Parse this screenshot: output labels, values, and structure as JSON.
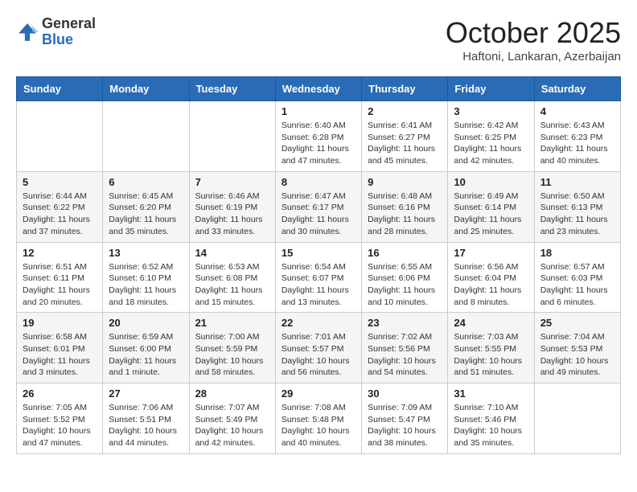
{
  "header": {
    "logo": {
      "general": "General",
      "blue": "Blue"
    },
    "month": "October 2025",
    "location": "Haftoni, Lankaran, Azerbaijan"
  },
  "weekdays": [
    "Sunday",
    "Monday",
    "Tuesday",
    "Wednesday",
    "Thursday",
    "Friday",
    "Saturday"
  ],
  "weeks": [
    [
      {
        "day": "",
        "info": ""
      },
      {
        "day": "",
        "info": ""
      },
      {
        "day": "",
        "info": ""
      },
      {
        "day": "1",
        "info": "Sunrise: 6:40 AM\nSunset: 6:28 PM\nDaylight: 11 hours\nand 47 minutes."
      },
      {
        "day": "2",
        "info": "Sunrise: 6:41 AM\nSunset: 6:27 PM\nDaylight: 11 hours\nand 45 minutes."
      },
      {
        "day": "3",
        "info": "Sunrise: 6:42 AM\nSunset: 6:25 PM\nDaylight: 11 hours\nand 42 minutes."
      },
      {
        "day": "4",
        "info": "Sunrise: 6:43 AM\nSunset: 6:23 PM\nDaylight: 11 hours\nand 40 minutes."
      }
    ],
    [
      {
        "day": "5",
        "info": "Sunrise: 6:44 AM\nSunset: 6:22 PM\nDaylight: 11 hours\nand 37 minutes."
      },
      {
        "day": "6",
        "info": "Sunrise: 6:45 AM\nSunset: 6:20 PM\nDaylight: 11 hours\nand 35 minutes."
      },
      {
        "day": "7",
        "info": "Sunrise: 6:46 AM\nSunset: 6:19 PM\nDaylight: 11 hours\nand 33 minutes."
      },
      {
        "day": "8",
        "info": "Sunrise: 6:47 AM\nSunset: 6:17 PM\nDaylight: 11 hours\nand 30 minutes."
      },
      {
        "day": "9",
        "info": "Sunrise: 6:48 AM\nSunset: 6:16 PM\nDaylight: 11 hours\nand 28 minutes."
      },
      {
        "day": "10",
        "info": "Sunrise: 6:49 AM\nSunset: 6:14 PM\nDaylight: 11 hours\nand 25 minutes."
      },
      {
        "day": "11",
        "info": "Sunrise: 6:50 AM\nSunset: 6:13 PM\nDaylight: 11 hours\nand 23 minutes."
      }
    ],
    [
      {
        "day": "12",
        "info": "Sunrise: 6:51 AM\nSunset: 6:11 PM\nDaylight: 11 hours\nand 20 minutes."
      },
      {
        "day": "13",
        "info": "Sunrise: 6:52 AM\nSunset: 6:10 PM\nDaylight: 11 hours\nand 18 minutes."
      },
      {
        "day": "14",
        "info": "Sunrise: 6:53 AM\nSunset: 6:08 PM\nDaylight: 11 hours\nand 15 minutes."
      },
      {
        "day": "15",
        "info": "Sunrise: 6:54 AM\nSunset: 6:07 PM\nDaylight: 11 hours\nand 13 minutes."
      },
      {
        "day": "16",
        "info": "Sunrise: 6:55 AM\nSunset: 6:06 PM\nDaylight: 11 hours\nand 10 minutes."
      },
      {
        "day": "17",
        "info": "Sunrise: 6:56 AM\nSunset: 6:04 PM\nDaylight: 11 hours\nand 8 minutes."
      },
      {
        "day": "18",
        "info": "Sunrise: 6:57 AM\nSunset: 6:03 PM\nDaylight: 11 hours\nand 6 minutes."
      }
    ],
    [
      {
        "day": "19",
        "info": "Sunrise: 6:58 AM\nSunset: 6:01 PM\nDaylight: 11 hours\nand 3 minutes."
      },
      {
        "day": "20",
        "info": "Sunrise: 6:59 AM\nSunset: 6:00 PM\nDaylight: 11 hours\nand 1 minute."
      },
      {
        "day": "21",
        "info": "Sunrise: 7:00 AM\nSunset: 5:59 PM\nDaylight: 10 hours\nand 58 minutes."
      },
      {
        "day": "22",
        "info": "Sunrise: 7:01 AM\nSunset: 5:57 PM\nDaylight: 10 hours\nand 56 minutes."
      },
      {
        "day": "23",
        "info": "Sunrise: 7:02 AM\nSunset: 5:56 PM\nDaylight: 10 hours\nand 54 minutes."
      },
      {
        "day": "24",
        "info": "Sunrise: 7:03 AM\nSunset: 5:55 PM\nDaylight: 10 hours\nand 51 minutes."
      },
      {
        "day": "25",
        "info": "Sunrise: 7:04 AM\nSunset: 5:53 PM\nDaylight: 10 hours\nand 49 minutes."
      }
    ],
    [
      {
        "day": "26",
        "info": "Sunrise: 7:05 AM\nSunset: 5:52 PM\nDaylight: 10 hours\nand 47 minutes."
      },
      {
        "day": "27",
        "info": "Sunrise: 7:06 AM\nSunset: 5:51 PM\nDaylight: 10 hours\nand 44 minutes."
      },
      {
        "day": "28",
        "info": "Sunrise: 7:07 AM\nSunset: 5:49 PM\nDaylight: 10 hours\nand 42 minutes."
      },
      {
        "day": "29",
        "info": "Sunrise: 7:08 AM\nSunset: 5:48 PM\nDaylight: 10 hours\nand 40 minutes."
      },
      {
        "day": "30",
        "info": "Sunrise: 7:09 AM\nSunset: 5:47 PM\nDaylight: 10 hours\nand 38 minutes."
      },
      {
        "day": "31",
        "info": "Sunrise: 7:10 AM\nSunset: 5:46 PM\nDaylight: 10 hours\nand 35 minutes."
      },
      {
        "day": "",
        "info": ""
      }
    ]
  ]
}
